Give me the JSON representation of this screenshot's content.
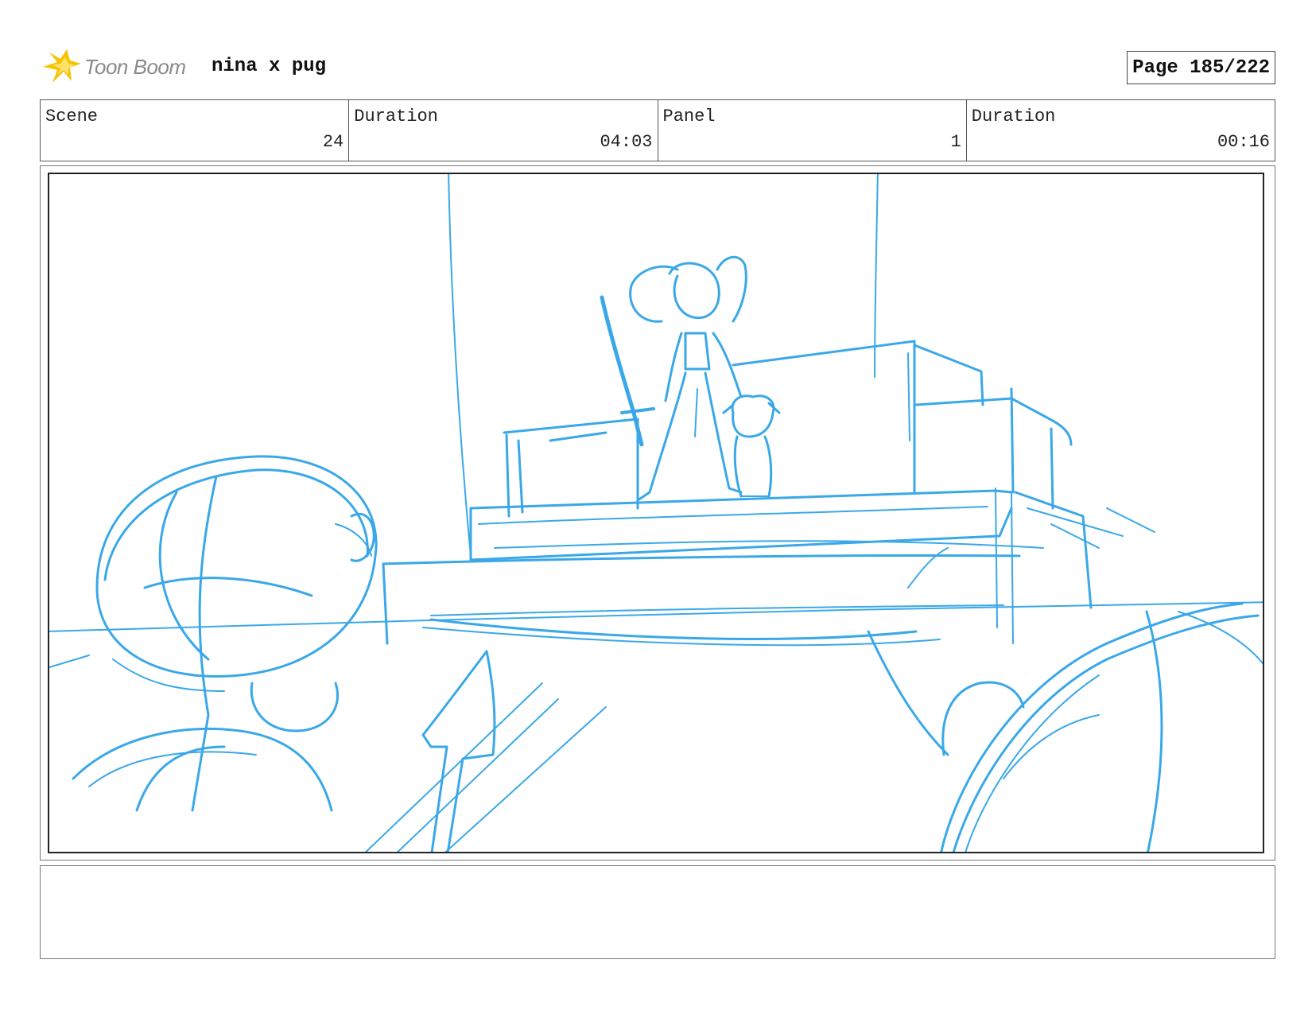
{
  "header": {
    "logo_text": "Toon Boom",
    "project_title": "nina x pug",
    "page_label": "Page 185/222"
  },
  "info": {
    "scene_label": "Scene",
    "scene_value": "24",
    "scene_duration_label": "Duration",
    "scene_duration_value": "04:03",
    "panel_label": "Panel",
    "panel_value": "1",
    "panel_duration_label": "Duration",
    "panel_duration_value": "00:16"
  },
  "notes": {
    "text": ""
  },
  "colors": {
    "sketch": "#3aa8e8",
    "logo_star": "#f5c400"
  },
  "icons": {
    "logo": "toon-boom-star-icon"
  }
}
